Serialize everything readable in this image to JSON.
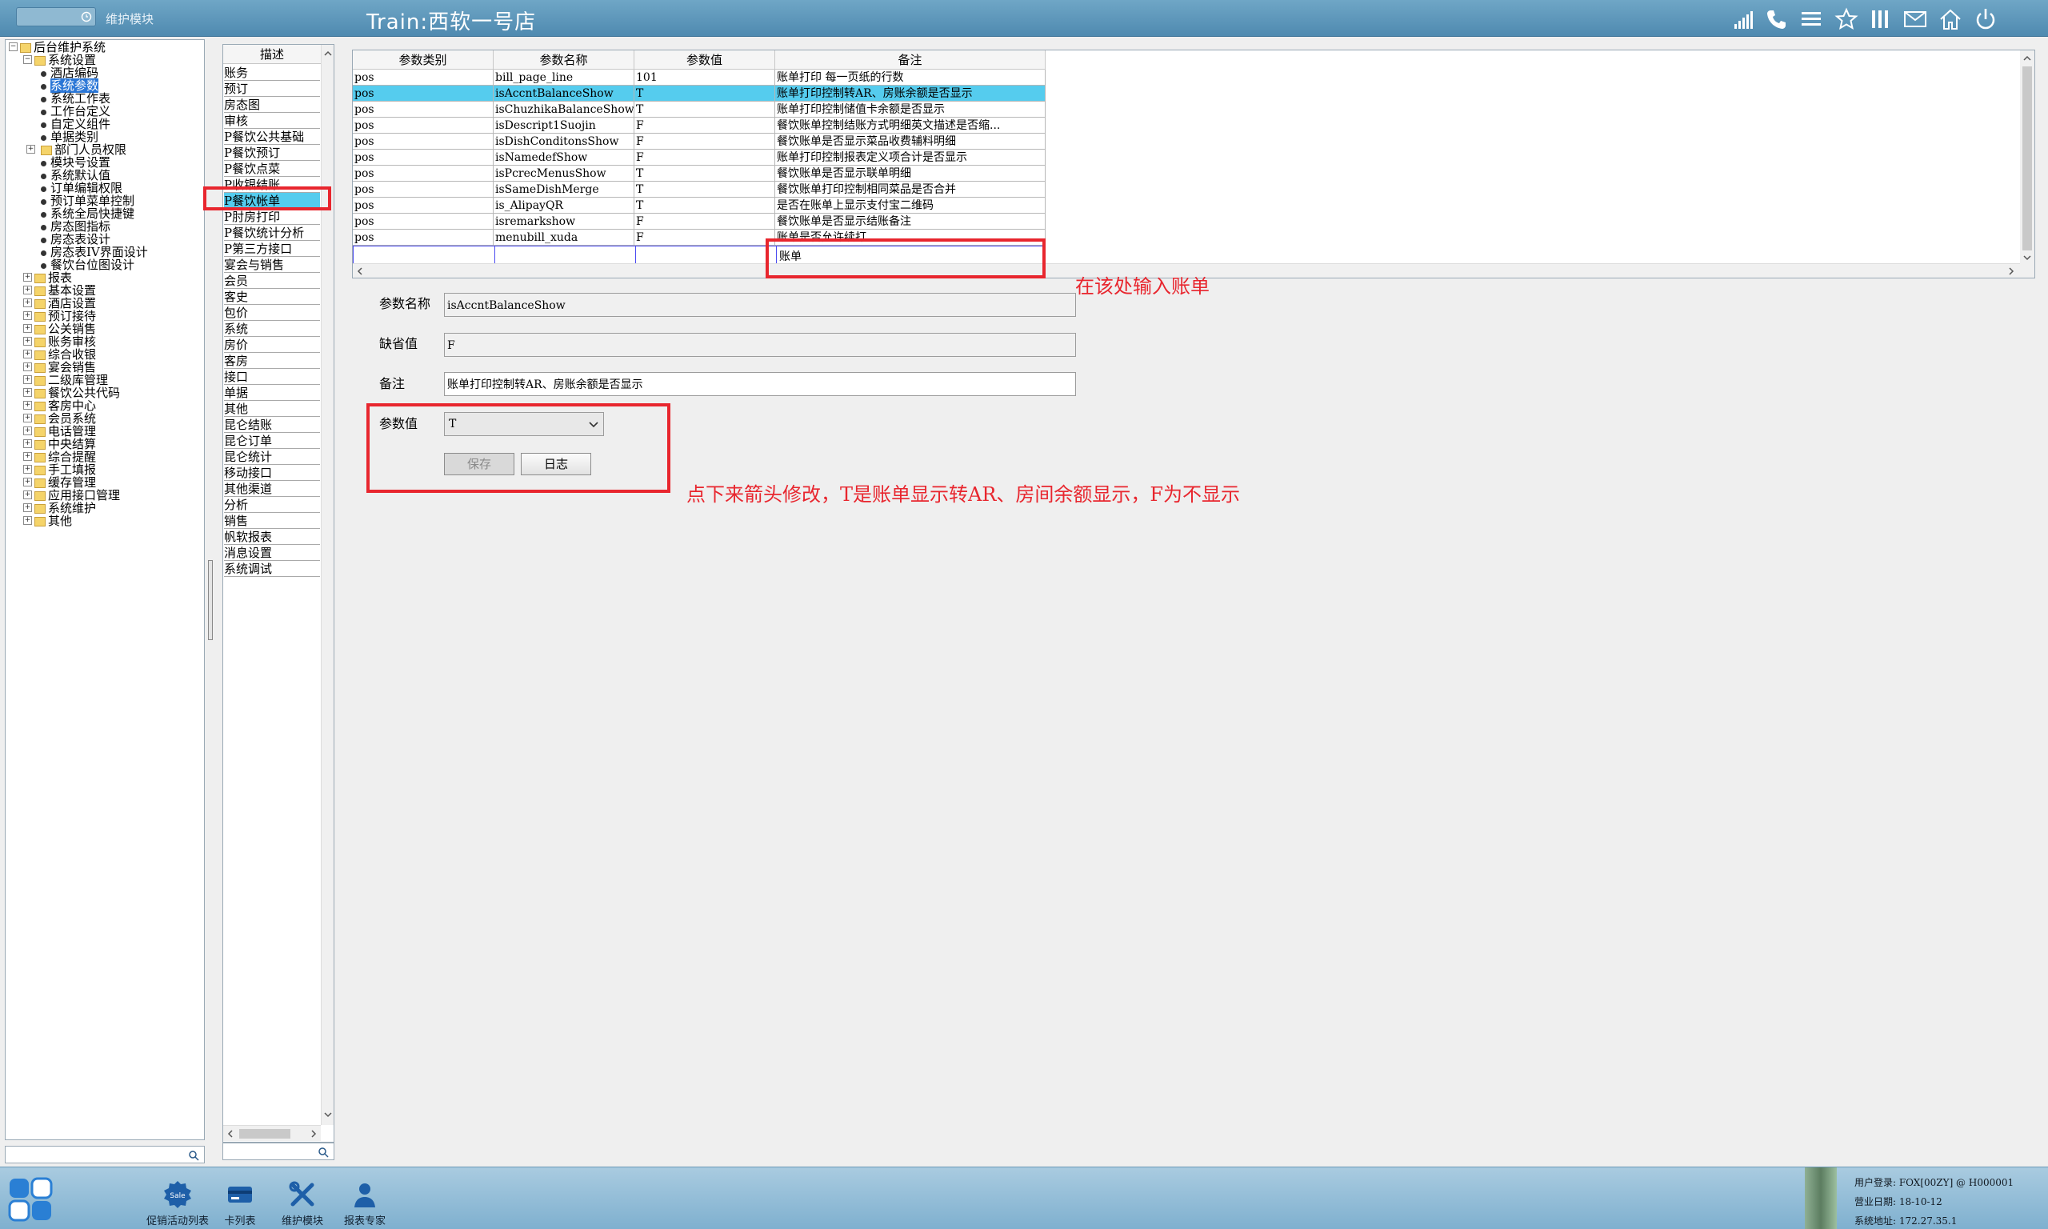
{
  "header": {
    "module": "维护模块",
    "title": "Train:西软一号店"
  },
  "tree": [
    {
      "label": "后台维护系统",
      "level": 0,
      "kind": "folder",
      "expand": "-"
    },
    {
      "label": "系统设置",
      "level": 1,
      "kind": "folder",
      "expand": "-"
    },
    {
      "label": "酒店编码",
      "level": 2,
      "kind": "bullet"
    },
    {
      "label": "系统参数",
      "level": 2,
      "kind": "bullet",
      "selected": true
    },
    {
      "label": "系统工作表",
      "level": 2,
      "kind": "bullet"
    },
    {
      "label": "工作台定义",
      "level": 2,
      "kind": "bullet"
    },
    {
      "label": "自定义组件",
      "level": 2,
      "kind": "bullet"
    },
    {
      "label": "单据类别",
      "level": 2,
      "kind": "bullet"
    },
    {
      "label": "部门人员权限",
      "level": 2,
      "kind": "folder",
      "expand": "+"
    },
    {
      "label": "模块号设置",
      "level": 2,
      "kind": "bullet"
    },
    {
      "label": "系统默认值",
      "level": 2,
      "kind": "bullet"
    },
    {
      "label": "订单编辑权限",
      "level": 2,
      "kind": "bullet"
    },
    {
      "label": "预订单菜单控制",
      "level": 2,
      "kind": "bullet"
    },
    {
      "label": "系统全局快捷键",
      "level": 2,
      "kind": "bullet"
    },
    {
      "label": "房态图指标",
      "level": 2,
      "kind": "bullet"
    },
    {
      "label": "房态表设计",
      "level": 2,
      "kind": "bullet"
    },
    {
      "label": "房态表IV界面设计",
      "level": 2,
      "kind": "bullet"
    },
    {
      "label": "餐饮台位图设计",
      "level": 2,
      "kind": "bullet"
    },
    {
      "label": "报表",
      "level": 1,
      "kind": "folder",
      "expand": "+"
    },
    {
      "label": "基本设置",
      "level": 1,
      "kind": "folder",
      "expand": "+"
    },
    {
      "label": "酒店设置",
      "level": 1,
      "kind": "folder",
      "expand": "+"
    },
    {
      "label": "预订接待",
      "level": 1,
      "kind": "folder",
      "expand": "+"
    },
    {
      "label": "公关销售",
      "level": 1,
      "kind": "folder",
      "expand": "+"
    },
    {
      "label": "账务审核",
      "level": 1,
      "kind": "folder",
      "expand": "+"
    },
    {
      "label": "综合收银",
      "level": 1,
      "kind": "folder",
      "expand": "+"
    },
    {
      "label": "宴会销售",
      "level": 1,
      "kind": "folder",
      "expand": "+"
    },
    {
      "label": "二级库管理",
      "level": 1,
      "kind": "folder",
      "expand": "+"
    },
    {
      "label": "餐饮公共代码",
      "level": 1,
      "kind": "folder",
      "expand": "+"
    },
    {
      "label": "客房中心",
      "level": 1,
      "kind": "folder",
      "expand": "+"
    },
    {
      "label": "会员系统",
      "level": 1,
      "kind": "folder",
      "expand": "+"
    },
    {
      "label": "电话管理",
      "level": 1,
      "kind": "folder",
      "expand": "+"
    },
    {
      "label": "中央结算",
      "level": 1,
      "kind": "folder",
      "expand": "+"
    },
    {
      "label": "综合提醒",
      "level": 1,
      "kind": "folder",
      "expand": "+"
    },
    {
      "label": "手工填报",
      "level": 1,
      "kind": "folder",
      "expand": "+"
    },
    {
      "label": "缓存管理",
      "level": 1,
      "kind": "folder",
      "expand": "+"
    },
    {
      "label": "应用接口管理",
      "level": 1,
      "kind": "folder",
      "expand": "+"
    },
    {
      "label": "系统维护",
      "level": 1,
      "kind": "folder",
      "expand": "+"
    },
    {
      "label": "其他",
      "level": 1,
      "kind": "folder",
      "expand": "+"
    }
  ],
  "desc_panel": {
    "header": "描述",
    "items": [
      "账务",
      "预订",
      "房态图",
      "审核",
      "P餐饮公共基础",
      "P餐饮预订",
      "P餐饮点菜",
      "P收银结账",
      "P餐饮帐单",
      "P肘房打印",
      "P餐饮统计分析",
      "P第三方接口",
      "宴会与销售",
      "会员",
      "客史",
      "包价",
      "系统",
      "房价",
      "客房",
      "接口",
      "单据",
      "其他",
      "昆仑结账",
      "昆仑订单",
      "昆仑统计",
      "移动接口",
      "其他渠道",
      "分析",
      "销售",
      "帆软报表",
      "消息设置",
      "系统调试"
    ],
    "selected_index": 8
  },
  "grid": {
    "columns": [
      "参数类别",
      "参数名称",
      "参数值",
      "备注"
    ],
    "rows": [
      [
        "pos",
        "bill_page_line",
        "101",
        "账单打印 每一页纸的行数"
      ],
      [
        "pos",
        "isAccntBalanceShow",
        "T",
        "账单打印控制转AR、房账余额是否显示"
      ],
      [
        "pos",
        "isChuzhikaBalanceShow",
        "T",
        "账单打印控制储值卡余额是否显示"
      ],
      [
        "pos",
        "isDescript1Suojin",
        "F",
        "餐饮账单控制结账方式明细英文描述是否缩..."
      ],
      [
        "pos",
        "isDishConditonsShow",
        "F",
        "餐饮账单是否显示菜品收费辅料明细"
      ],
      [
        "pos",
        "isNamedefShow",
        "F",
        "账单打印控制报表定义项合计是否显示"
      ],
      [
        "pos",
        "isPcrecMenusShow",
        "T",
        "餐饮账单是否显示联单明细"
      ],
      [
        "pos",
        "isSameDishMerge",
        "T",
        "餐饮账单打印控制相同菜品是否合并"
      ],
      [
        "pos",
        "is_AlipayQR",
        "T",
        "是否在账单上显示支付宝二维码"
      ],
      [
        "pos",
        "isremarkshow",
        "F",
        "餐饮账单是否显示结账备注"
      ],
      [
        "pos",
        "menubill_xuda",
        "F",
        "账单是否允许续打"
      ]
    ],
    "selected_index": 1,
    "filter_value": "账单"
  },
  "form": {
    "name_label": "参数名称",
    "name_value": "isAccntBalanceShow",
    "default_label": "缺省值",
    "default_value": "F",
    "remark_label": "备注",
    "remark_value": "账单打印控制转AR、房账余额是否显示",
    "value_label": "参数值",
    "value_selected": "T",
    "save_label": "保存",
    "log_label": "日志"
  },
  "annotations": {
    "filter_hint": "在该处输入账单",
    "value_hint": "点下来箭头修改，T是账单显示转AR、房间余额显示，F为不显示"
  },
  "dock": {
    "items": [
      "促销活动列表",
      "卡列表",
      "维护模块",
      "报表专家"
    ]
  },
  "status": {
    "user": "用户登录: FOX[00ZY] @ H000001",
    "date": "营业日期: 18-10-12",
    "address": "系统地址: 172.27.35.1"
  },
  "colors": {
    "selected_row": "#55ccee",
    "annotation": "#e8262e",
    "tree_selected": "#2a76d6"
  }
}
